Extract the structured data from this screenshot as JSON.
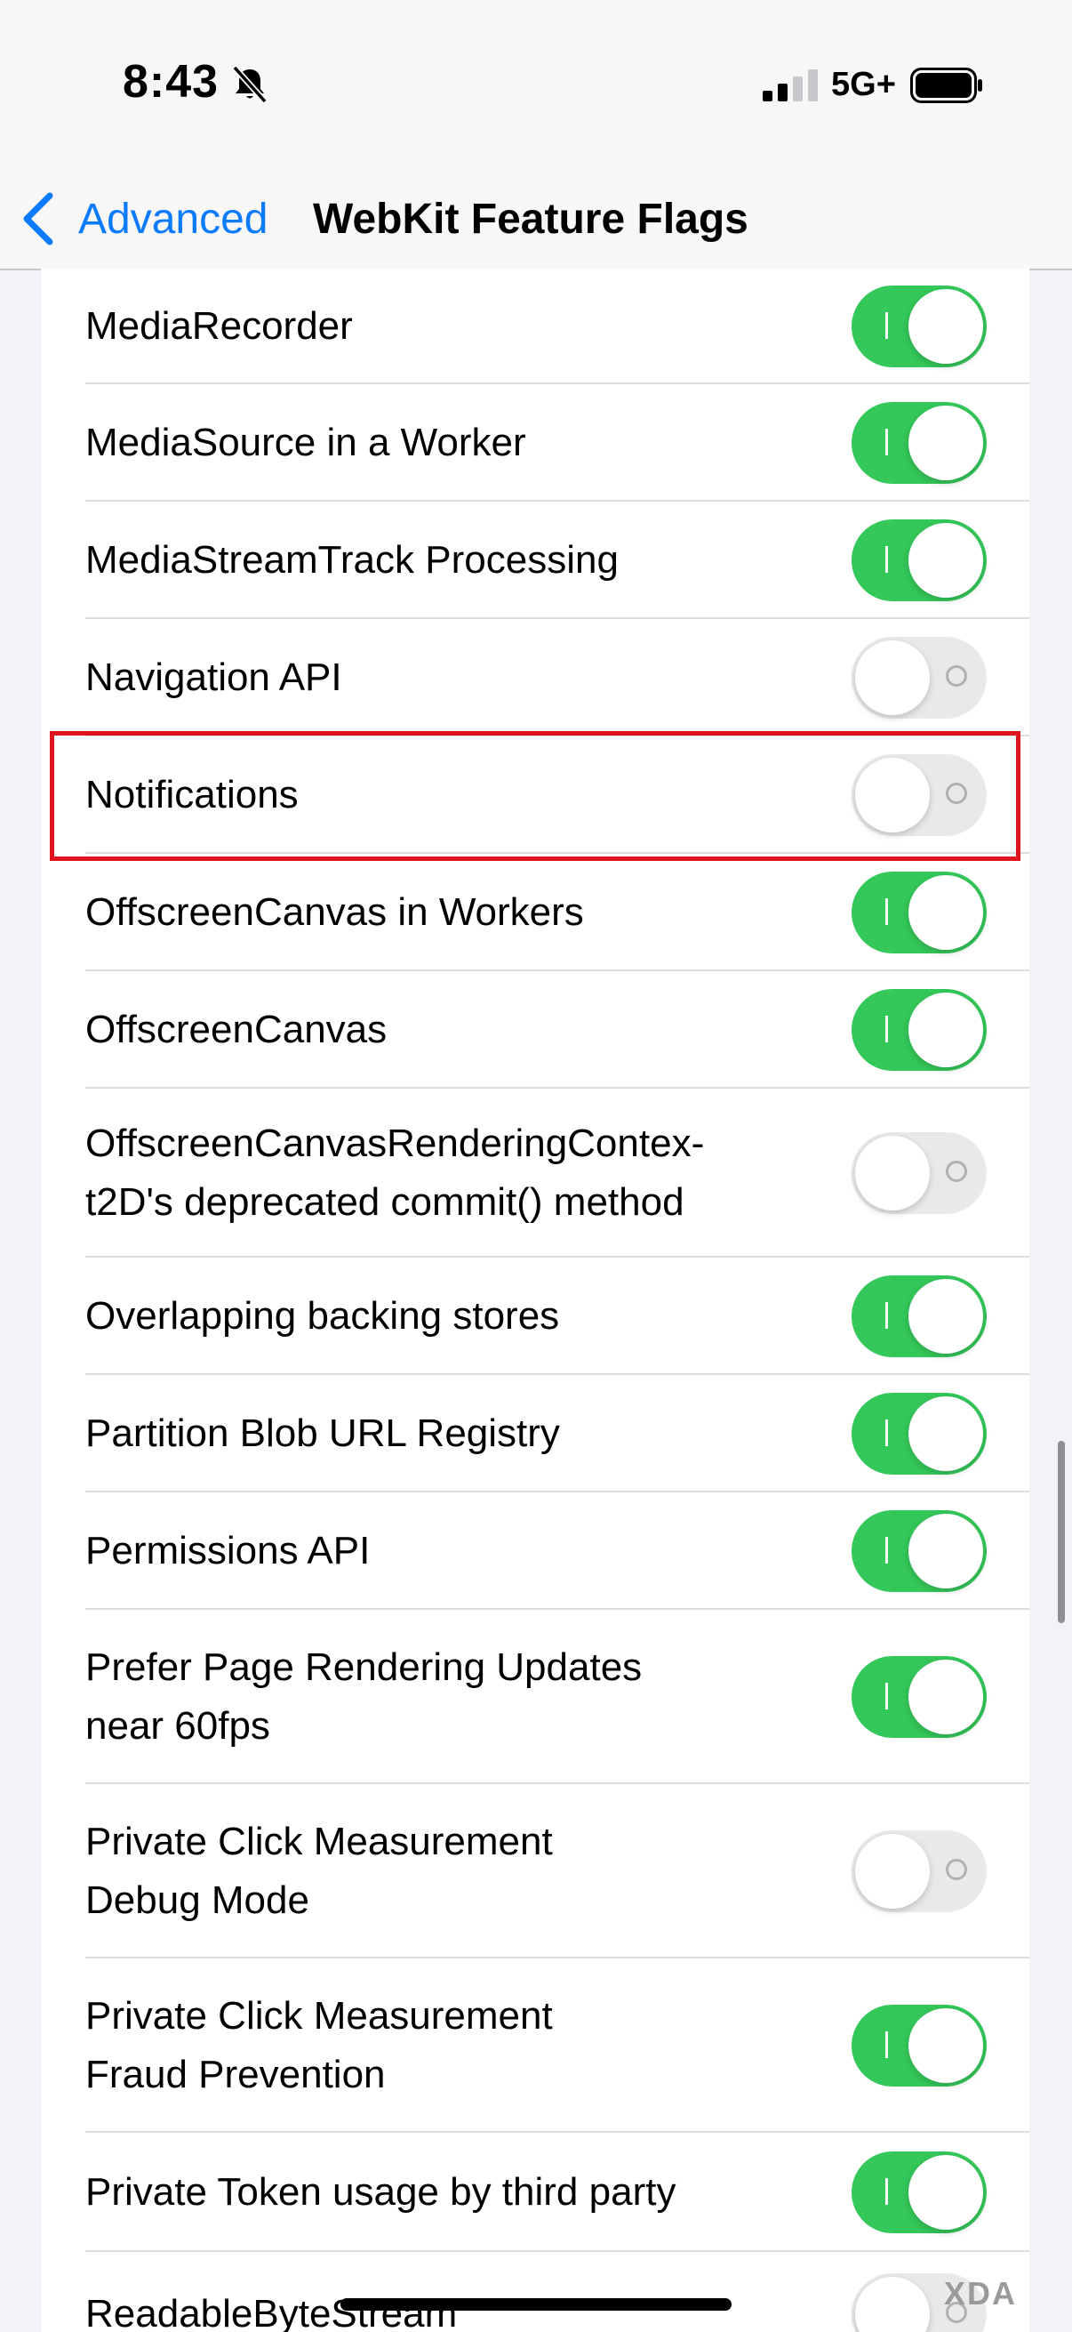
{
  "status_bar": {
    "time": "8:43",
    "network": "5G+",
    "icons": [
      "bell-slash-icon",
      "cellular-signal-icon",
      "battery-icon"
    ]
  },
  "nav": {
    "back_label": "Advanced",
    "title": "WebKit Feature Flags"
  },
  "colors": {
    "toggle_on": "#34c759",
    "toggle_off": "#e9e9ea",
    "accent": "#0a7aff",
    "highlight": "#e0141e"
  },
  "flags": [
    {
      "label": "MediaRecorder",
      "on": true
    },
    {
      "label": "MediaSource in a Worker",
      "on": true
    },
    {
      "label": "MediaStreamTrack Processing",
      "on": true
    },
    {
      "label": "Navigation API",
      "on": false
    },
    {
      "label": "Notifications",
      "on": false
    },
    {
      "label": "OffscreenCanvas in Workers",
      "on": true
    },
    {
      "label": "OffscreenCanvas",
      "on": true
    },
    {
      "label": "OffscreenCanvasRenderingContex-\nt2D's deprecated commit() method",
      "on": false
    },
    {
      "label": "Overlapping backing stores",
      "on": true
    },
    {
      "label": "Partition Blob URL Registry",
      "on": true
    },
    {
      "label": "Permissions API",
      "on": true
    },
    {
      "label": "Prefer Page Rendering Updates\nnear 60fps",
      "on": true
    },
    {
      "label": "Private Click Measurement\nDebug Mode",
      "on": false
    },
    {
      "label": "Private Click Measurement\nFraud Prevention",
      "on": true
    },
    {
      "label": "Private Token usage by third party",
      "on": true
    },
    {
      "label": "ReadableByteStream",
      "on": false
    }
  ],
  "watermark": "XDA"
}
